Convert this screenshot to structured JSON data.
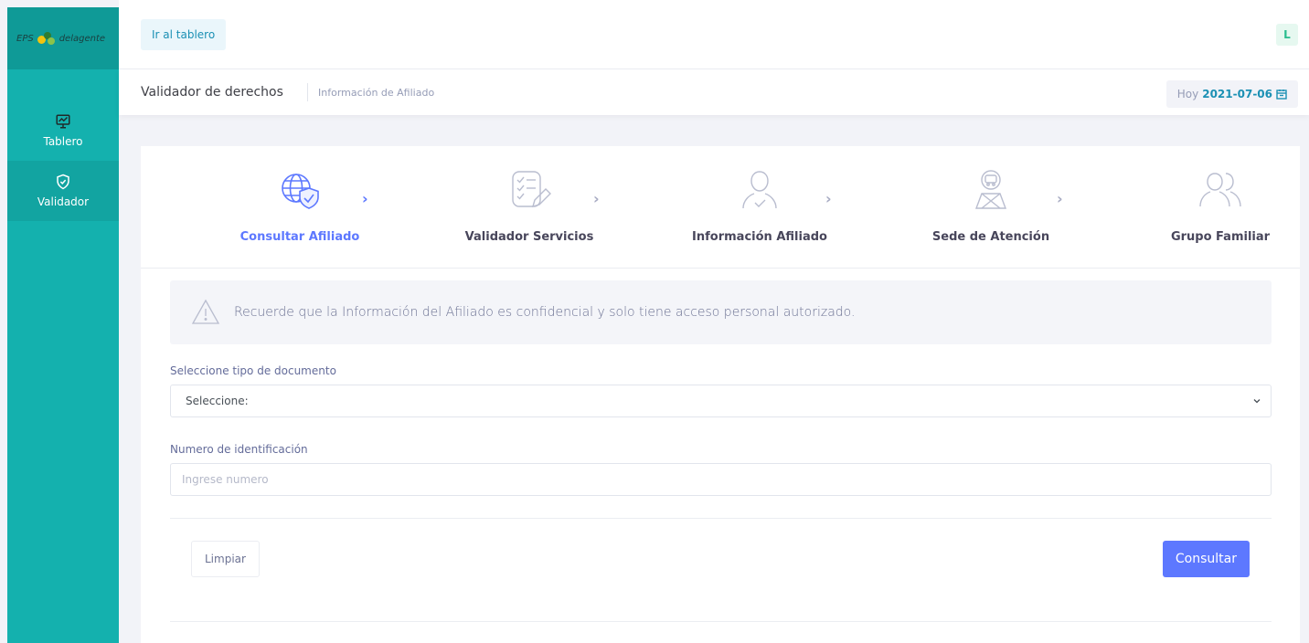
{
  "brand": {
    "text_left": "EPS",
    "text_right": "delagente"
  },
  "sidebar": {
    "items": [
      {
        "label": "Tablero",
        "icon": "monitor-chart-icon",
        "active": false
      },
      {
        "label": "Validador",
        "icon": "shield-check-icon",
        "active": true
      }
    ]
  },
  "topbar": {
    "dashboard_button": "Ir al tablero",
    "avatar_letter": "L"
  },
  "subheader": {
    "title": "Validador de derechos",
    "breadcrumb": "Información de Afiliado",
    "date_label": "Hoy",
    "date_value": "2021-07-06"
  },
  "wizard": {
    "steps": [
      {
        "label": "Consultar Afiliado",
        "icon": "globe-shield-icon",
        "active": true
      },
      {
        "label": "Validador Servicios",
        "icon": "checklist-pencil-icon",
        "active": false
      },
      {
        "label": "Información Afiliado",
        "icon": "user-check-icon",
        "active": false
      },
      {
        "label": "Sede de Atención",
        "icon": "person-bus-icon",
        "active": false
      },
      {
        "label": "Grupo Familiar",
        "icon": "users-icon",
        "active": false
      }
    ]
  },
  "alert": {
    "text": "Recuerde que la Información del Afiliado es confidencial y solo tiene acceso personal autorizado."
  },
  "form": {
    "doc_type_label": "Seleccione tipo de documento",
    "doc_type_value": "Seleccione:",
    "id_label": "Numero de identificación",
    "id_placeholder": "Ingrese numero",
    "id_value": ""
  },
  "actions": {
    "clear_label": "Limpiar",
    "submit_label": "Consultar"
  },
  "colors": {
    "sidebar": "#14b1ae",
    "accent": "#5d78ff",
    "link": "#1b90b4"
  }
}
